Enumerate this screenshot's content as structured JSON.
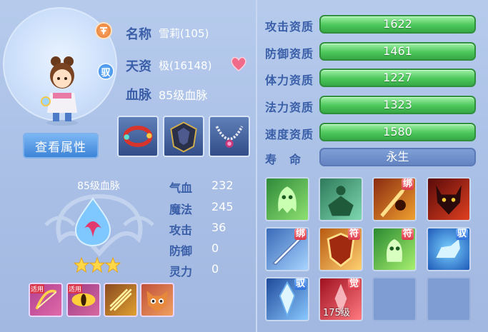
{
  "pet": {
    "name_label": "名称",
    "name_value": "雪莉(105)",
    "talent_label": "天资",
    "talent_value": "极(16148)",
    "bloodline_label": "血脉",
    "bloodline_value": "85级血脉",
    "tame_badge": "驭",
    "view_button": "查看属性"
  },
  "items": [
    {
      "icon": "red-bracelet-icon"
    },
    {
      "icon": "dark-armor-icon"
    },
    {
      "icon": "pearl-necklace-icon"
    }
  ],
  "bloodline": {
    "title": "85级血脉",
    "stars": 3,
    "stats": [
      {
        "label": "气血",
        "value": "232"
      },
      {
        "label": "魔法",
        "value": "245"
      },
      {
        "label": "攻击",
        "value": "36"
      },
      {
        "label": "防御",
        "value": "0"
      },
      {
        "label": "灵力",
        "value": "0"
      }
    ],
    "skills": [
      {
        "icon": "golden-bow-skill-icon",
        "badge": "适用"
      },
      {
        "icon": "golden-eye-skill-icon",
        "badge": "适用"
      },
      {
        "icon": "golden-slash-skill-icon",
        "badge": ""
      },
      {
        "icon": "fox-mask-skill-icon",
        "badge": ""
      }
    ]
  },
  "aptitudes": [
    {
      "label": "攻击资质",
      "value": "1622"
    },
    {
      "label": "防御资质",
      "value": "1461"
    },
    {
      "label": "体力资质",
      "value": "1227"
    },
    {
      "label": "法力资质",
      "value": "1323"
    },
    {
      "label": "速度资质",
      "value": "1580"
    }
  ],
  "lifespan": {
    "label": "寿　命",
    "value": "永生"
  },
  "skills": [
    {
      "icon": "green-ghost-skill-icon",
      "tag": ""
    },
    {
      "icon": "green-shadow-skill-icon",
      "tag": ""
    },
    {
      "icon": "bind-strike-skill-icon",
      "tag": "绑"
    },
    {
      "icon": "demon-head-skill-icon",
      "tag": ""
    },
    {
      "icon": "sword-skill-icon",
      "tag": "绑"
    },
    {
      "icon": "talisman-shield-skill-icon",
      "tag": "符"
    },
    {
      "icon": "green-spirit-skill-icon",
      "tag": "符"
    },
    {
      "icon": "ice-beast-skill-icon",
      "tag": "驭"
    },
    {
      "icon": "ice-crystal-skill-icon",
      "tag": "驭"
    },
    {
      "icon": "crimson-awaken-skill-icon",
      "tag": "觉",
      "level": "175级"
    },
    {
      "icon": "empty-slot",
      "tag": ""
    },
    {
      "icon": "empty-slot",
      "tag": ""
    }
  ],
  "colors": {
    "label": "#3a5fa8",
    "bar_green": "#4cc75a",
    "life_bar": "#6384c2"
  }
}
